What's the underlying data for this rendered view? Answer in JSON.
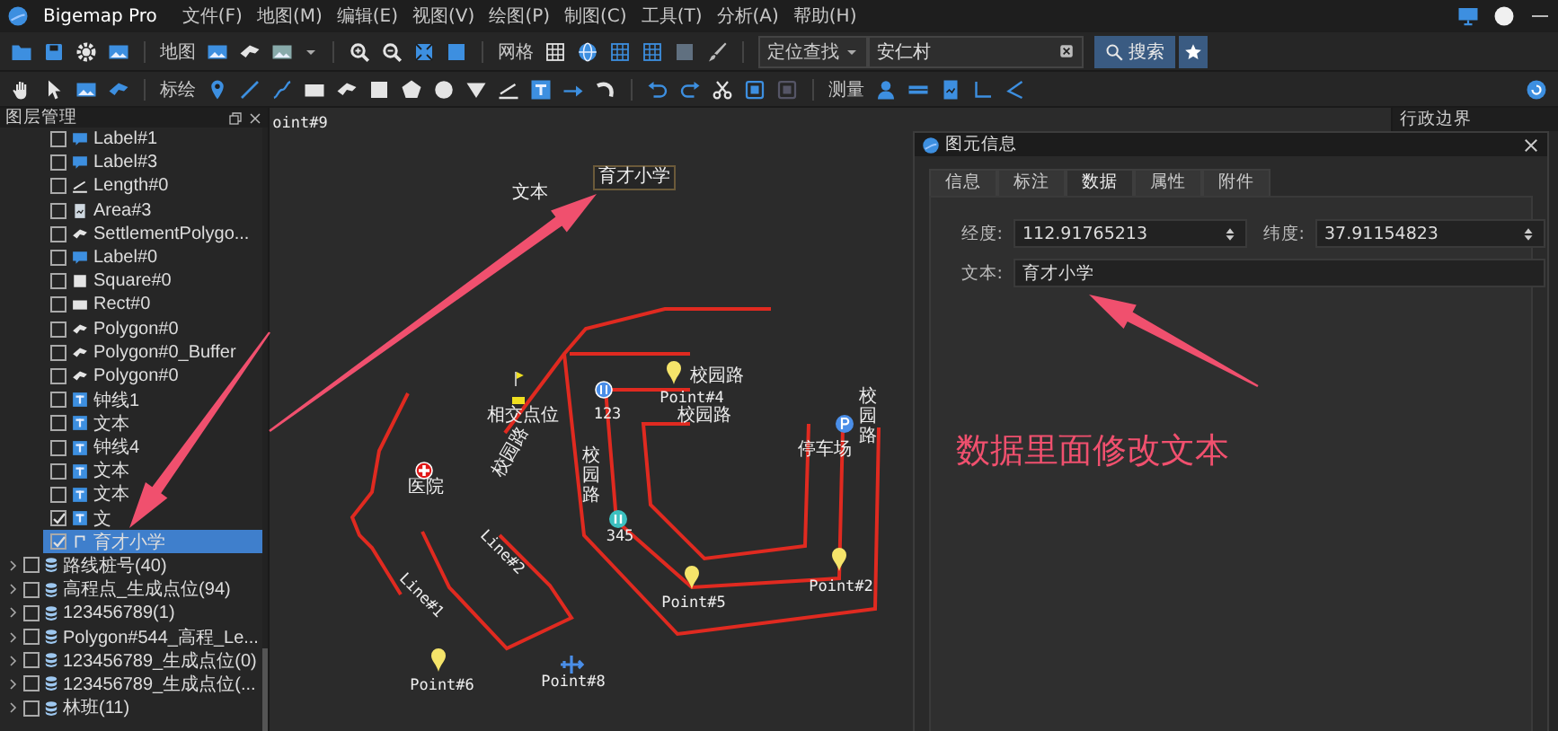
{
  "app": {
    "title": "Bigemap Pro"
  },
  "menu": [
    "文件(F)",
    "地图(M)",
    "编辑(E)",
    "视图(V)",
    "绘图(P)",
    "制图(C)",
    "工具(T)",
    "分析(A)",
    "帮助(H)"
  ],
  "toolbar": {
    "map_label": "地图",
    "grid_label": "网格",
    "locate_mode": "定位查找",
    "search_value": "安仁村",
    "search_button": "搜索"
  },
  "toolbar2": {
    "plot_label": "标绘",
    "measure_label": "测量"
  },
  "layer_panel": {
    "title": "图层管理",
    "items": [
      {
        "label": "Label#1",
        "kind": "label",
        "checked": false,
        "selected": false
      },
      {
        "label": "Label#3",
        "kind": "label",
        "checked": false,
        "selected": false
      },
      {
        "label": "Length#0",
        "kind": "length",
        "checked": false,
        "selected": false
      },
      {
        "label": "Area#3",
        "kind": "area",
        "checked": false,
        "selected": false
      },
      {
        "label": "SettlementPolygo...",
        "kind": "polygon",
        "checked": false,
        "selected": false
      },
      {
        "label": "Label#0",
        "kind": "label",
        "checked": false,
        "selected": false
      },
      {
        "label": "Square#0",
        "kind": "square",
        "checked": false,
        "selected": false
      },
      {
        "label": "Rect#0",
        "kind": "rect",
        "checked": false,
        "selected": false
      },
      {
        "label": "Polygon#0",
        "kind": "polygon",
        "checked": false,
        "selected": false
      },
      {
        "label": "Polygon#0_Buffer",
        "kind": "polygon",
        "checked": false,
        "selected": false
      },
      {
        "label": "Polygon#0",
        "kind": "polygon",
        "checked": false,
        "selected": false
      },
      {
        "label": "钟线1",
        "kind": "text",
        "checked": false,
        "selected": false
      },
      {
        "label": "文本",
        "kind": "text",
        "checked": false,
        "selected": false
      },
      {
        "label": "钟线4",
        "kind": "text",
        "checked": false,
        "selected": false
      },
      {
        "label": "文本",
        "kind": "text",
        "checked": false,
        "selected": false
      },
      {
        "label": "文本",
        "kind": "text",
        "checked": false,
        "selected": false
      },
      {
        "label": "文",
        "kind": "text",
        "checked": true,
        "selected": false
      },
      {
        "label": "育才小学",
        "kind": "mark",
        "checked": true,
        "selected": true
      }
    ],
    "groups": [
      {
        "label": "路线桩号(40)",
        "checked": false,
        "expanded": false
      },
      {
        "label": "高程点_生成点位(94)",
        "checked": false,
        "expanded": false
      },
      {
        "label": "123456789(1)",
        "checked": false,
        "expanded": false
      },
      {
        "label": "Polygon#544_高程_Le...",
        "checked": false,
        "expanded": false
      },
      {
        "label": "123456789_生成点位(0)",
        "checked": false,
        "expanded": false
      },
      {
        "label": "123456789_生成点位(...",
        "checked": false,
        "expanded": false
      },
      {
        "label": "林班(11)",
        "checked": false,
        "expanded": false
      }
    ]
  },
  "map": {
    "labels": [
      {
        "text": "oint#9"
      },
      {
        "text": "育才小学"
      },
      {
        "text": "文本"
      },
      {
        "text": "校园路"
      },
      {
        "text": "相交点位"
      },
      {
        "text": "123"
      },
      {
        "text": "Point#4"
      },
      {
        "text": "校园路"
      },
      {
        "text": "校园路"
      },
      {
        "text": "停车场"
      },
      {
        "text": "医院"
      },
      {
        "text": "校园路"
      },
      {
        "text": "校园路"
      },
      {
        "text": "345"
      },
      {
        "text": "Line#2"
      },
      {
        "text": "Point#2"
      },
      {
        "text": "Line#1"
      },
      {
        "text": "Point#5"
      },
      {
        "text": "Point#8"
      },
      {
        "text": "Point#6"
      }
    ]
  },
  "side_panel": {
    "title": "行政边界"
  },
  "dialog": {
    "title": "图元信息",
    "tabs": [
      {
        "label": "信息",
        "selected": false
      },
      {
        "label": "标注",
        "selected": false
      },
      {
        "label": "数据",
        "selected": true
      },
      {
        "label": "属性",
        "selected": false
      },
      {
        "label": "附件",
        "selected": false
      }
    ],
    "fields": [
      {
        "label": "经度:",
        "value": "112.91765213",
        "kind": "spin"
      },
      {
        "label": "纬度:",
        "value": "37.91154823",
        "kind": "spin"
      },
      {
        "label": "文本:",
        "value": "育才小学",
        "kind": "text"
      }
    ],
    "annotation": "数据里面修改文本"
  }
}
